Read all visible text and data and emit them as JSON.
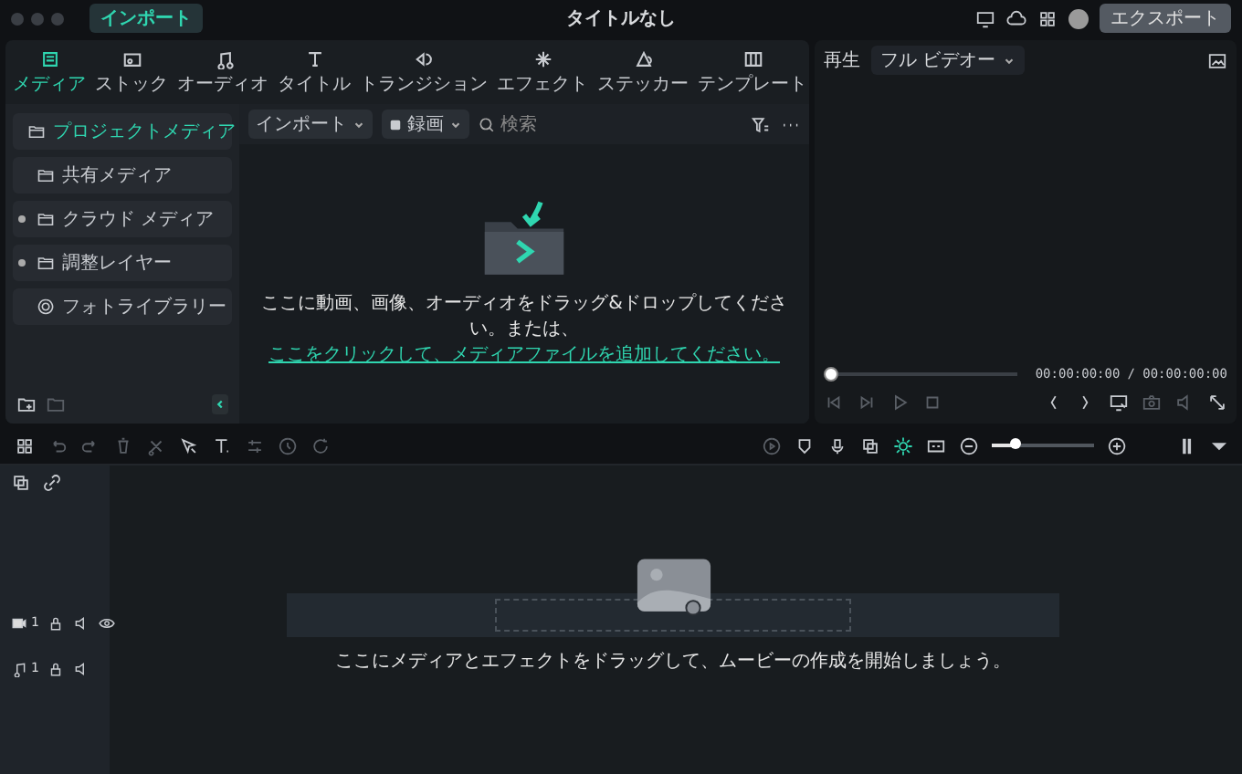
{
  "window": {
    "title": "タイトルなし",
    "import_button": "インポート",
    "export_button": "エクスポート"
  },
  "tabs": [
    {
      "label": "メディア",
      "selected": true
    },
    {
      "label": "ストック",
      "selected": false
    },
    {
      "label": "オーディオ",
      "selected": false
    },
    {
      "label": "タイトル",
      "selected": false
    },
    {
      "label": "トランジション",
      "selected": false
    },
    {
      "label": "エフェクト",
      "selected": false
    },
    {
      "label": "ステッカー",
      "selected": false
    },
    {
      "label": "テンプレート",
      "selected": false
    }
  ],
  "media_toolbar": {
    "import_dropdown": "インポート",
    "record_dropdown": "録画",
    "search": {
      "placeholder": "検索"
    }
  },
  "sidebar": {
    "items": [
      {
        "label": "プロジェクトメディア",
        "selected": true,
        "expandable": false,
        "kind": "folder"
      },
      {
        "label": "共有メディア",
        "selected": false,
        "expandable": false,
        "kind": "folder"
      },
      {
        "label": "クラウド メディア",
        "selected": false,
        "expandable": true,
        "kind": "folder"
      },
      {
        "label": "調整レイヤー",
        "selected": false,
        "expandable": true,
        "kind": "folder"
      },
      {
        "label": "フォトライブラリー",
        "selected": false,
        "expandable": false,
        "kind": "photos"
      }
    ]
  },
  "empty_media": {
    "text": "ここに動画、画像、オーディオをドラッグ&ドロップしてください。または、",
    "link": "ここをクリックして、メディアファイルを追加してください。"
  },
  "preview": {
    "label": "再生",
    "quality": "フル ビデオー",
    "current_time": "00:00:00:00",
    "total_time": "/ 00:00:00:00",
    "level": 0
  },
  "timeline": {
    "zoom_slider": {
      "level": 0.25
    },
    "tracks": [
      {
        "kind": "video",
        "number": "1"
      },
      {
        "kind": "audio",
        "number": "1"
      }
    ],
    "hint": "ここにメディアとエフェクトをドラッグして、ムービーの作成を開始しましょう。"
  }
}
